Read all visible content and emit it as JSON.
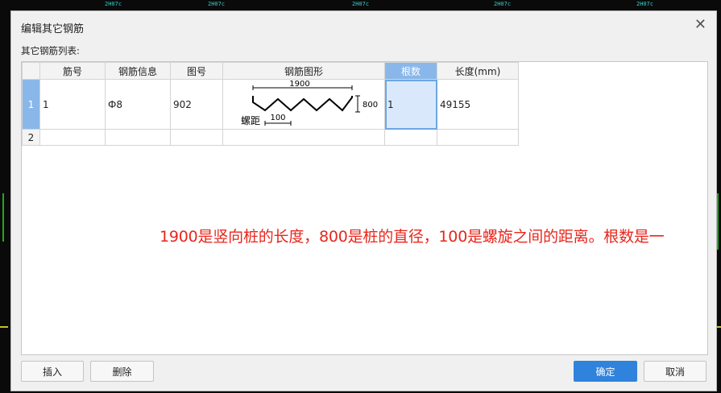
{
  "dialog": {
    "title": "编辑其它钢筋",
    "close_icon": "close-icon",
    "list_label": "其它钢筋列表:"
  },
  "table": {
    "headers": [
      "筋号",
      "钢筋信息",
      "图号",
      "钢筋图形",
      "根数",
      "长度(mm)"
    ],
    "active_header_index": 4,
    "rows": [
      {
        "row_number": "1",
        "bar_no": "1",
        "rebar_info": "Ф8",
        "figure_no": "902",
        "shape": {
          "length": "1900",
          "diameter": "800",
          "pitch": "100",
          "pitch_label": "螺距"
        },
        "count": "1",
        "length_mm": "49155"
      },
      {
        "row_number": "2",
        "bar_no": "",
        "rebar_info": "",
        "figure_no": "",
        "count": "",
        "length_mm": ""
      }
    ]
  },
  "annotation": "1900是竖向桩的长度，800是桩的直径，100是螺旋之间的距离。根数是一",
  "buttons": {
    "insert": "插入",
    "delete": "删除",
    "ok": "确定",
    "cancel": "取消"
  },
  "background_labels": [
    "2H07c",
    "2H07c",
    "2H07c",
    "2H07c",
    "2H07c"
  ],
  "colors": {
    "accent": "#2f83dc",
    "annotation": "#e8261c",
    "selected_header": "#8ab7ea"
  }
}
